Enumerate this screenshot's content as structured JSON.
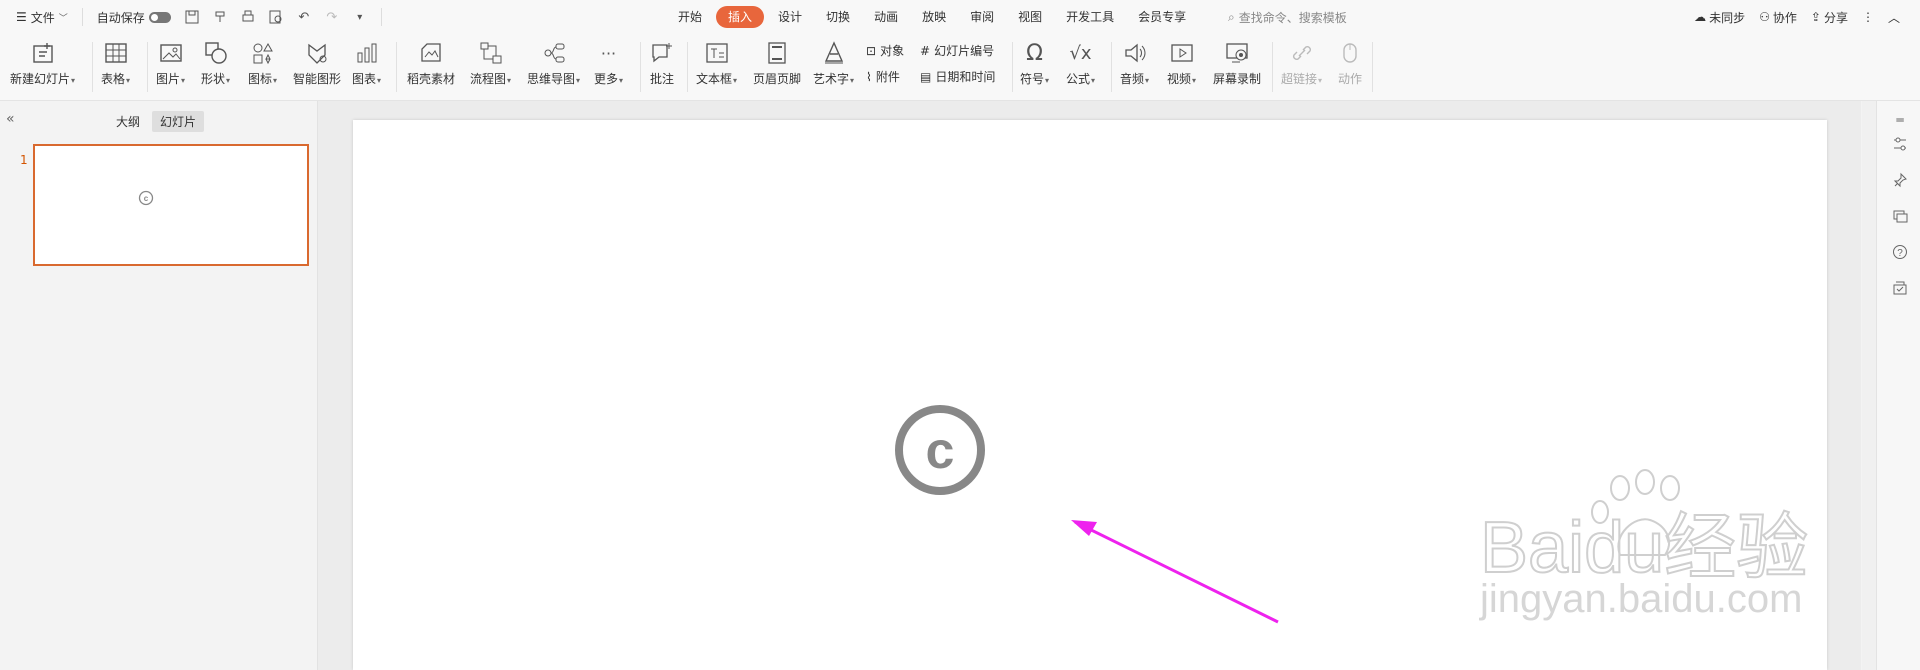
{
  "topbar": {
    "menu_label": "文件",
    "autosave_label": "自动保存",
    "tabs": [
      {
        "label": "开始"
      },
      {
        "label": "插入"
      },
      {
        "label": "设计"
      },
      {
        "label": "切换"
      },
      {
        "label": "动画"
      },
      {
        "label": "放映"
      },
      {
        "label": "审阅"
      },
      {
        "label": "视图"
      },
      {
        "label": "开发工具"
      },
      {
        "label": "会员专享"
      }
    ],
    "active_tab": "插入",
    "search_placeholder": "查找命令、搜索模板",
    "sync_label": "未同步",
    "collab_label": "协作",
    "share_label": "分享"
  },
  "ribbon": {
    "new_slide": "新建幻灯片",
    "table": "表格",
    "picture": "图片",
    "shape": "形状",
    "icon": "图标",
    "smart_graphic": "智能图形",
    "chart": "图表",
    "docer_material": "稻壳素材",
    "flowchart": "流程图",
    "mindmap": "思维导图",
    "more": "更多",
    "comment": "批注",
    "textbox": "文本框",
    "header_footer": "页眉页脚",
    "wordart": "艺术字",
    "object": "对象",
    "attachment": "附件",
    "slide_number": "幻灯片编号",
    "date_time": "日期和时间",
    "symbol": "符号",
    "formula": "公式",
    "audio": "音频",
    "video": "视频",
    "screen_record": "屏幕录制",
    "hyperlink": "超链接",
    "action": "动作"
  },
  "left_panel": {
    "outline_tab": "大纲",
    "slides_tab": "幻灯片",
    "slide_number": "1"
  },
  "slide": {
    "symbol": "©"
  },
  "watermark": {
    "brand": "Baidu经验",
    "url": "jingyan.baidu.com"
  },
  "colors": {
    "accent": "#e8663c",
    "arrow": "#ee22ee",
    "symbol_gray": "#888888"
  }
}
